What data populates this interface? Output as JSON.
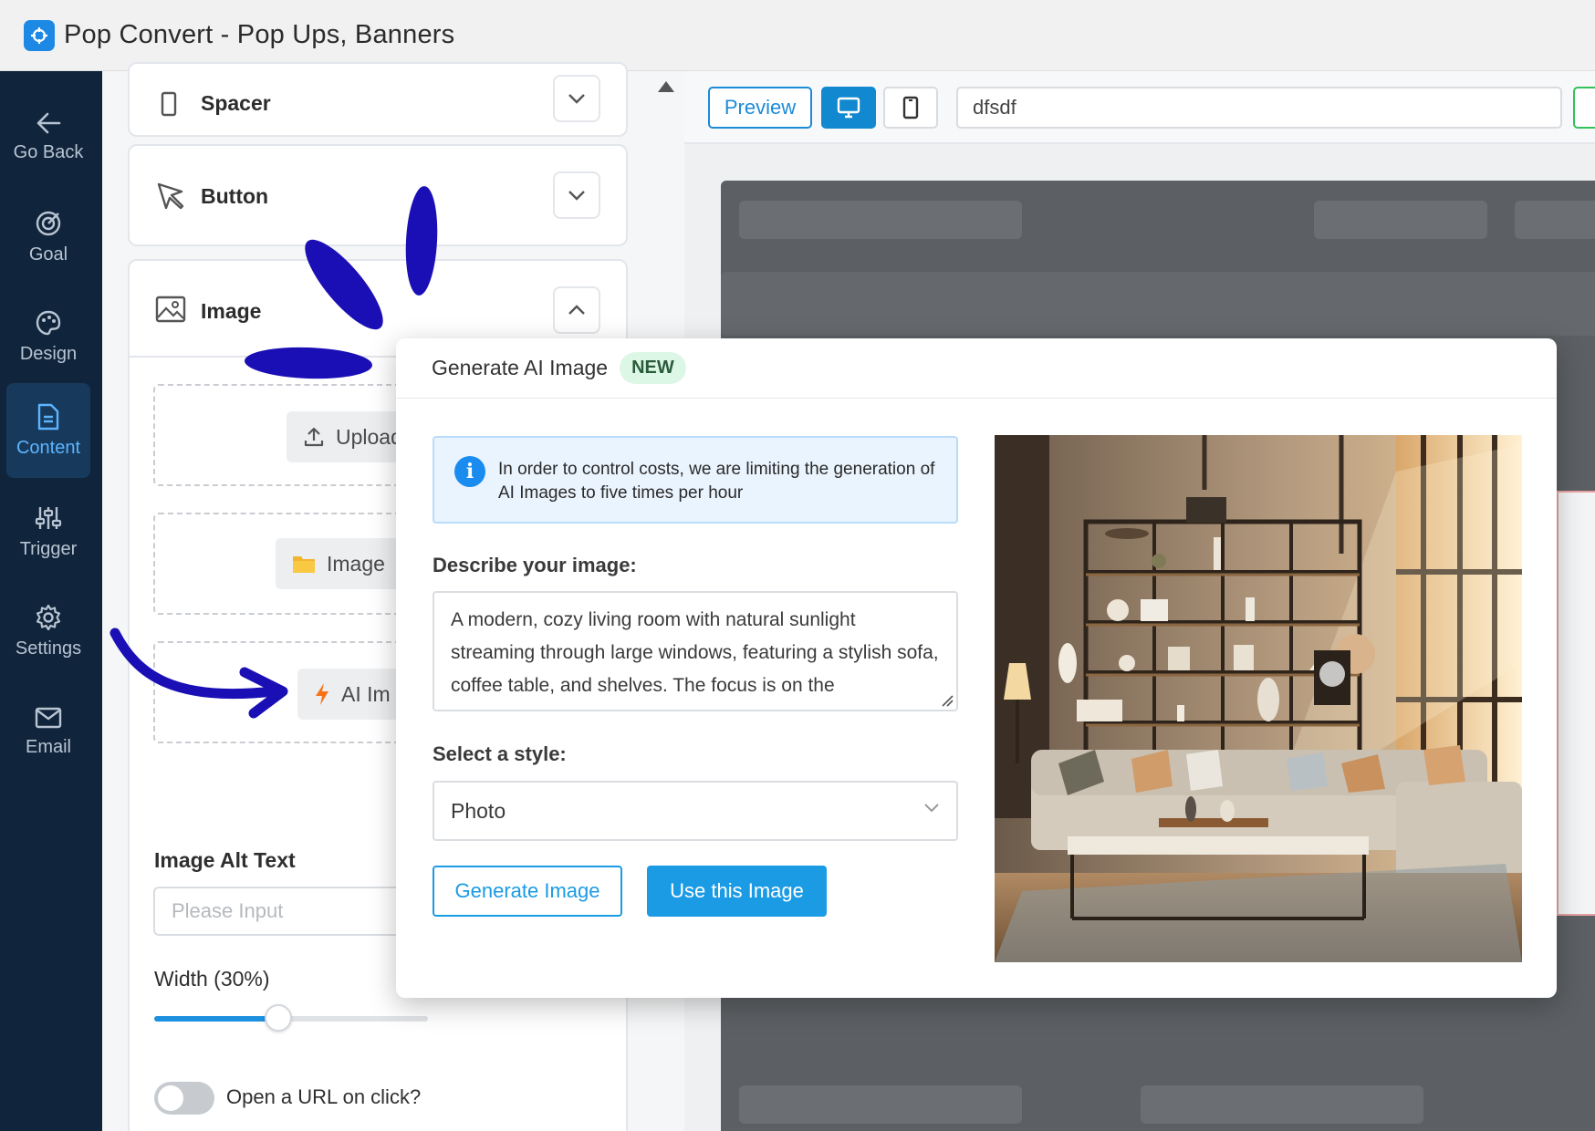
{
  "window": {
    "title": "Pop Convert - Pop Ups, Banners"
  },
  "sidebar": {
    "items": [
      {
        "label": "Go Back",
        "icon": "arrow-left-icon",
        "active": false
      },
      {
        "label": "Goal",
        "icon": "target-icon",
        "active": false
      },
      {
        "label": "Design",
        "icon": "palette-icon",
        "active": false
      },
      {
        "label": "Content",
        "icon": "document-icon",
        "active": true
      },
      {
        "label": "Trigger",
        "icon": "sliders-icon",
        "active": false
      },
      {
        "label": "Settings",
        "icon": "gear-icon",
        "active": false
      },
      {
        "label": "Email",
        "icon": "mail-icon",
        "active": false
      }
    ]
  },
  "panel": {
    "blocks": {
      "spacer": "Spacer",
      "button": "Button",
      "image": "Image"
    },
    "upload_label": "Upload",
    "image_library_label": "Image",
    "ai_image_label": "AI Im",
    "alt_text_label": "Image Alt Text",
    "alt_text_placeholder": "Please Input",
    "width_label": "Width (30%)",
    "width_value": 0.3,
    "open_url_label": "Open a URL on click?",
    "open_url_enabled": false
  },
  "toolbar": {
    "preview_label": "Preview",
    "campaign_name": "dfsdf",
    "active_device": "desktop"
  },
  "modal": {
    "title": "Generate AI Image",
    "badge": "NEW",
    "info": "In order to control costs, we are limiting the generation of AI Images to five times per hour",
    "describe_label": "Describe your image:",
    "prompt": "A modern, cozy living room with natural sunlight streaming through large windows, featuring a stylish sofa, coffee table, and shelves. The focus is on the",
    "style_label": "Select a style:",
    "style_value": "Photo",
    "generate_label": "Generate Image",
    "use_label": "Use this Image"
  },
  "colors": {
    "brand_blue": "#1a9be4",
    "sidebar_bg": "#10243b",
    "annotation": "#1a0fb5"
  }
}
